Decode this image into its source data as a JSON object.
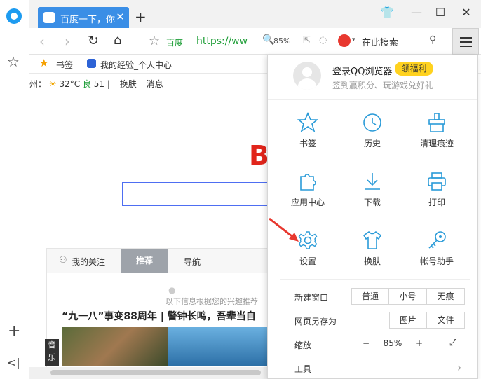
{
  "tab": {
    "title": "百度一下，你"
  },
  "address": {
    "site_name": "百度",
    "url": "https://ww",
    "zoom": "85%",
    "search_placeholder": "在此搜索"
  },
  "bookmarks": {
    "items": [
      "书签",
      "我的经验_个人中心"
    ]
  },
  "weather": {
    "city": "州：",
    "temp": "32°C",
    "aqi_label": "良",
    "aqi": "51",
    "sep": "|",
    "skin": "换肤",
    "msg": "消息"
  },
  "page": {
    "logo_letter": "B",
    "tabs": [
      "我的关注",
      "推荐",
      "导航"
    ],
    "hint": "以下信息根据您的兴趣推荐",
    "headline": "“九一八”事变88周年 | 警钟长鸣，吾辈当自",
    "music_label": "音乐"
  },
  "menu": {
    "login": "登录QQ浏览器",
    "reward": "领福利",
    "subtitle": "签到赢积分、玩游戏兑好礼",
    "grid": [
      {
        "label": "书签",
        "icon": "star-icon"
      },
      {
        "label": "历史",
        "icon": "clock-icon"
      },
      {
        "label": "清理痕迹",
        "icon": "broom-icon"
      },
      {
        "label": "应用中心",
        "icon": "puzzle-icon"
      },
      {
        "label": "下载",
        "icon": "download-icon"
      },
      {
        "label": "打印",
        "icon": "printer-icon"
      },
      {
        "label": "设置",
        "icon": "gear-icon"
      },
      {
        "label": "换肤",
        "icon": "shirt-icon"
      },
      {
        "label": "帐号助手",
        "icon": "key-icon"
      }
    ],
    "new_window": {
      "label": "新建窗口",
      "options": [
        "普通",
        "小号",
        "无痕"
      ]
    },
    "save_as": {
      "label": "网页另存为",
      "options": [
        "图片",
        "文件"
      ]
    },
    "zoom": {
      "label": "缩放",
      "minus": "−",
      "value": "85%",
      "plus": "+"
    },
    "tools": {
      "label": "工具"
    }
  },
  "colors": {
    "accent": "#3a8ee6",
    "icon_blue": "#2a9bd8",
    "reward_bg": "#ffd21f",
    "url_green": "#1f9e38",
    "arrow_red": "#e8382f"
  }
}
